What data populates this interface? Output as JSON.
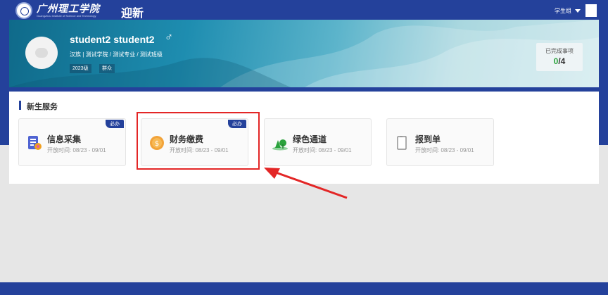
{
  "header": {
    "school_name": "广州理工学院",
    "school_name_en": "Guangzhou Institute of Science and Technology",
    "app_title": "迎新",
    "role_selector": "学生组"
  },
  "profile": {
    "name": "student2  student2",
    "gender_symbol": "♂",
    "info": "汉族 | 测试学院 / 测试专业 / 测试班级",
    "tags": [
      "2023级",
      "群众"
    ],
    "completed_label": "已完成事项",
    "completed_done": "0",
    "completed_total": "/4"
  },
  "services": {
    "section_title": "新生服务",
    "cards": [
      {
        "title": "信息采集",
        "time": "开放时间: 08/23 - 09/01",
        "required": "必办",
        "icon": "form-icon"
      },
      {
        "title": "财务缴费",
        "time": "开放时间: 08/23 - 09/01",
        "required": "必办",
        "icon": "coin-icon"
      },
      {
        "title": "绿色通道",
        "time": "开放时间: 08/23 - 09/01",
        "required": "",
        "icon": "green-channel-icon"
      },
      {
        "title": "报到单",
        "time": "开放时间: 08/23 - 09/01",
        "required": "",
        "icon": "document-icon"
      }
    ]
  },
  "colors": {
    "primary": "#24419b",
    "highlight_border": "#e32626",
    "completed_green": "#2aa23c"
  }
}
